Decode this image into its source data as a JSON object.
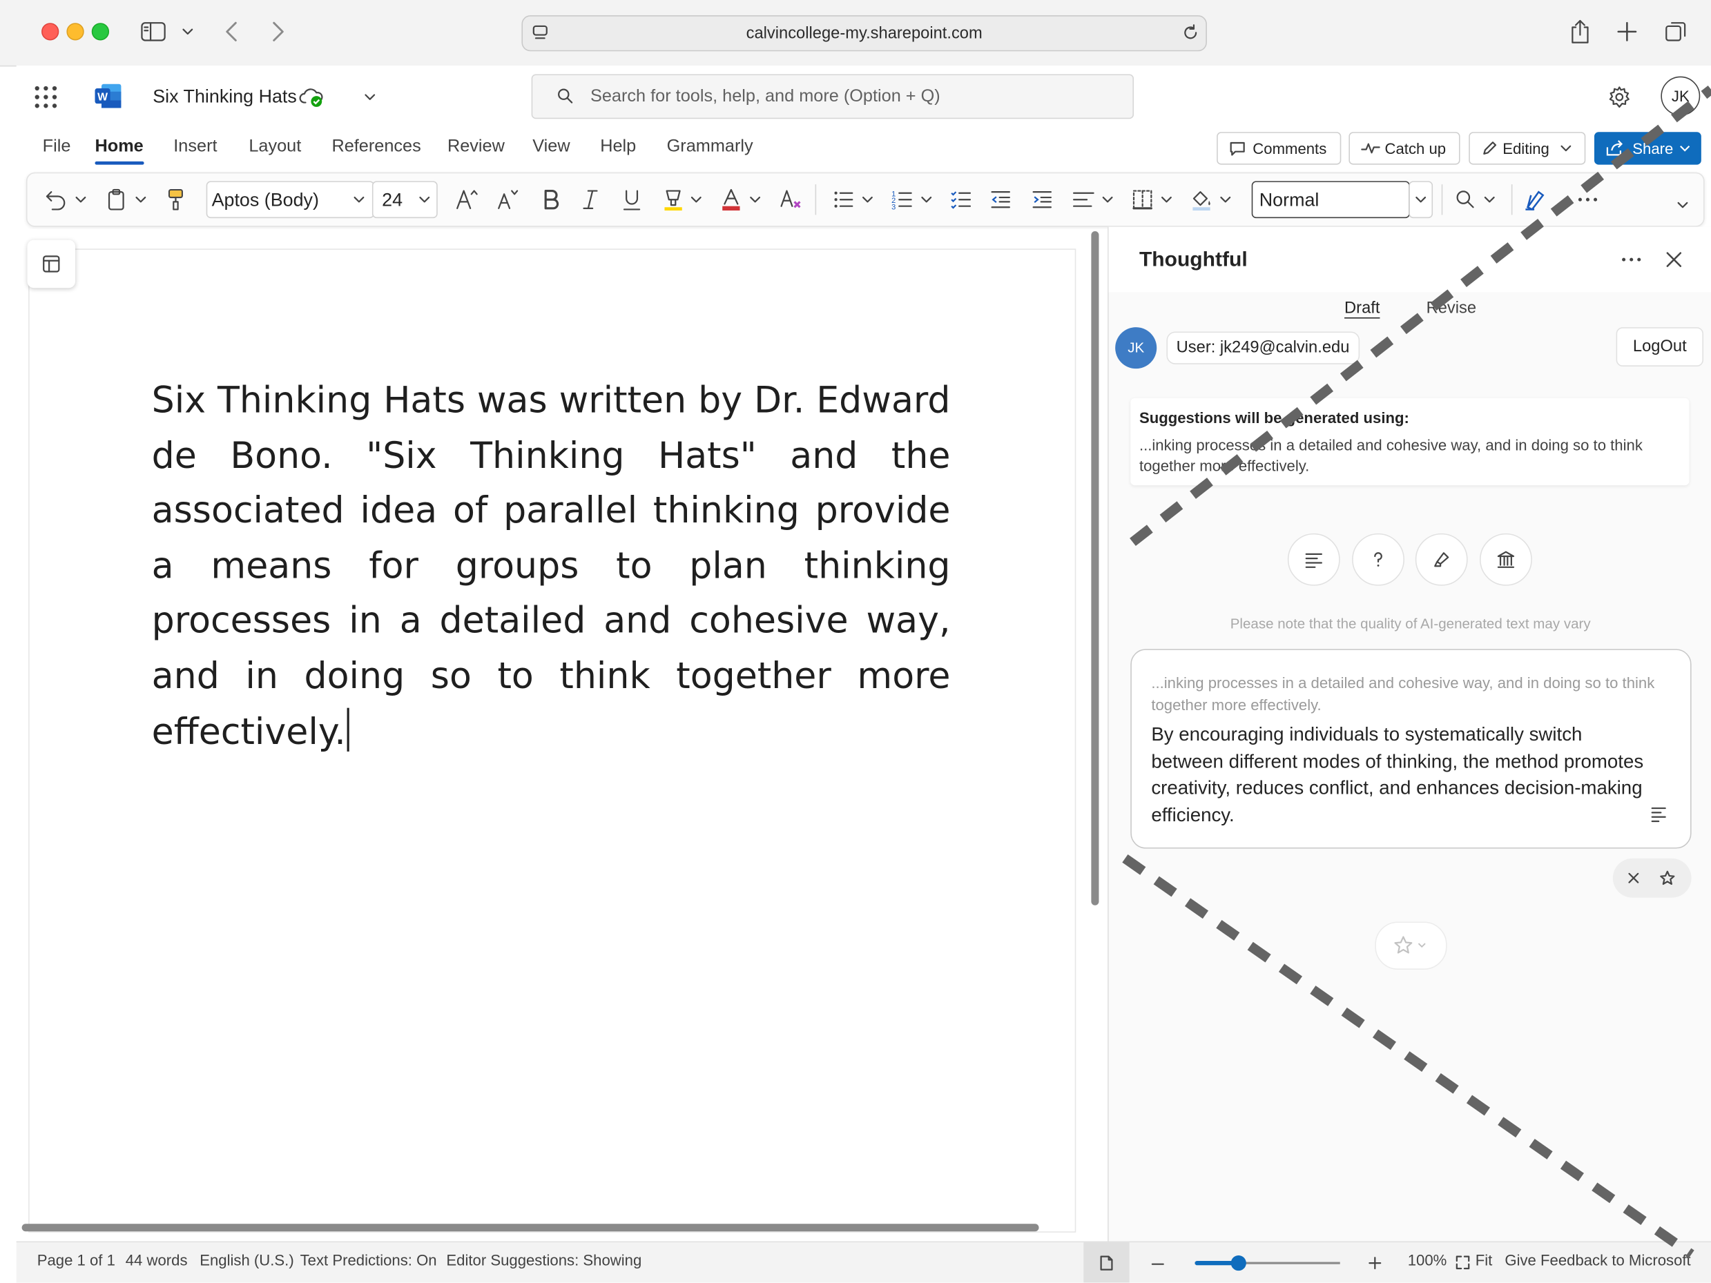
{
  "browser": {
    "url": "calvincollege-my.sharepoint.com"
  },
  "app": {
    "doc_title": "Six Thinking Hats",
    "search_placeholder": "Search for tools, help, and more (Option + Q)",
    "avatar_initials": "JK"
  },
  "menu": {
    "items": [
      "File",
      "Home",
      "Insert",
      "Layout",
      "References",
      "Review",
      "View",
      "Help",
      "Grammarly"
    ],
    "active": "Home",
    "comments": "Comments",
    "catch_up": "Catch up",
    "editing": "Editing",
    "share": "Share"
  },
  "ribbon": {
    "font": "Aptos (Body)",
    "size": "24",
    "style": "Normal"
  },
  "document": {
    "text": "Six Thinking Hats was written by Dr. Edward de Bono. \"Six Thinking Hats\" and the associated idea of parallel thinking provide a means for groups to plan thinking processes in a detailed and cohesive way, and in doing so to think together more effectively."
  },
  "pane": {
    "title": "Thoughtful",
    "tabs": [
      "Draft",
      "Revise"
    ],
    "user_initials": "JK",
    "user_label": "User: jk249@calvin.edu",
    "logout": "LogOut",
    "suggestions_heading": "Suggestions will be generated using:",
    "suggestions_context": "...inking processes in a detailed and cohesive way, and in doing so to think together more effectively.",
    "note": "Please note that the quality of AI-generated text may vary",
    "card_context": "...inking processes in a detailed and cohesive way, and in doing so to think together more effectively.",
    "card_suggestion": "By encouraging individuals to systematically switch between different modes of thinking, the method promotes creativity, reduces conflict, and enhances decision-making efficiency."
  },
  "status": {
    "page": "Page 1 of 1",
    "words": "44 words",
    "language": "English (U.S.)",
    "predictions": "Text Predictions: On",
    "editor": "Editor Suggestions: Showing",
    "zoom": "100%",
    "fit": "Fit",
    "feedback": "Give Feedback to Microsoft",
    "zoom_level": 0.3
  },
  "colors": {
    "word_blue": "#185abd",
    "share_blue": "#0f6cbd",
    "avatar_blue": "#3e7cc5",
    "font_color_red": "#d13438",
    "highlight_yellow": "#ffd700"
  }
}
